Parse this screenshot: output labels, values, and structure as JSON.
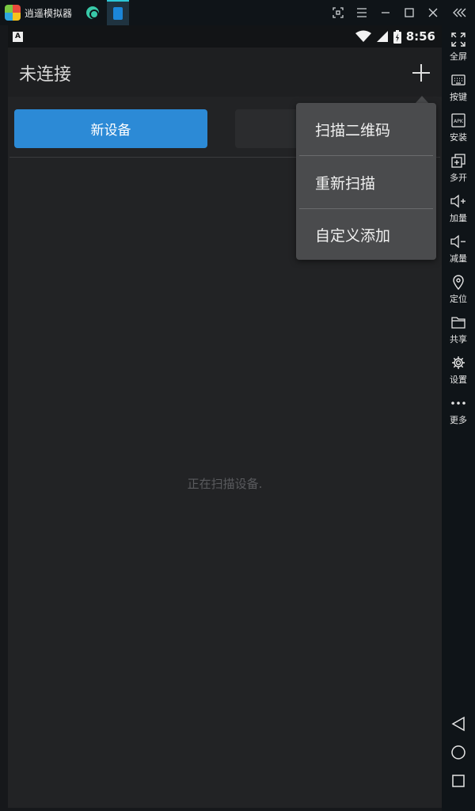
{
  "titlebar": {
    "app_name": "逍遥模拟器",
    "window_controls": [
      "expand-arrows-icon",
      "menu-icon",
      "minimize-icon",
      "maximize-icon",
      "close-icon",
      "collapse-chevrons-icon"
    ]
  },
  "statusbar": {
    "notification_letter": "A",
    "time": "8:56"
  },
  "appbar": {
    "title": "未连接"
  },
  "content": {
    "new_device_label": "新设备",
    "scanning_text": "正在扫描设备."
  },
  "menu": {
    "items": [
      {
        "label": "扫描二维码"
      },
      {
        "label": "重新扫描"
      },
      {
        "label": "自定义添加"
      }
    ]
  },
  "sidebar": {
    "items": [
      {
        "label": "全屏",
        "icon": "fullscreen-icon"
      },
      {
        "label": "按键",
        "icon": "keyboard-icon"
      },
      {
        "label": "安装",
        "icon": "apk-icon"
      },
      {
        "label": "多开",
        "icon": "multi-open-icon"
      },
      {
        "label": "加量",
        "icon": "volume-up-icon"
      },
      {
        "label": "减量",
        "icon": "volume-down-icon"
      },
      {
        "label": "定位",
        "icon": "location-icon"
      },
      {
        "label": "共享",
        "icon": "folder-icon"
      },
      {
        "label": "设置",
        "icon": "gear-icon"
      },
      {
        "label": "更多",
        "icon": "more-icon"
      }
    ],
    "apk_badge": "APK"
  },
  "colors": {
    "accent": "#2c8ad6",
    "background": "#222325",
    "menu_bg": "#4a4b4d"
  }
}
